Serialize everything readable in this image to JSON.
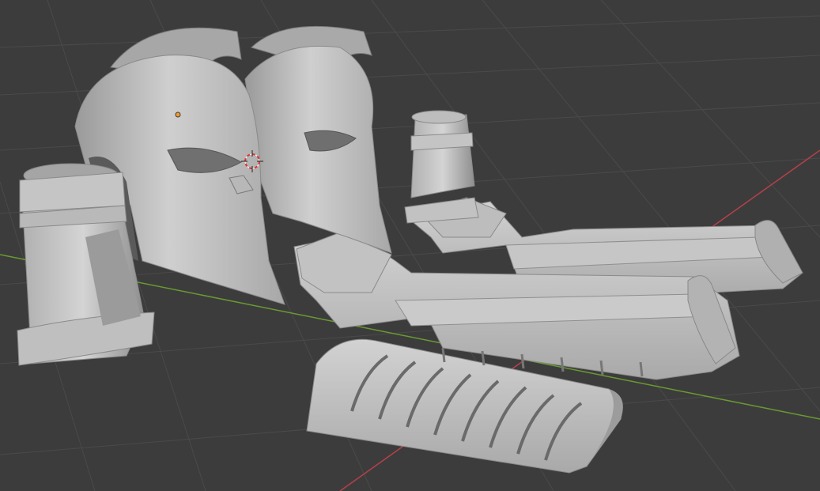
{
  "viewport": {
    "background": "#3c3c3c",
    "grid_color": "#4a4a4a",
    "x_axis_color": "#b5404a",
    "y_axis_color": "#6a9a32",
    "mesh_color": "#c8c8c8",
    "origin_color": "#f29a2e",
    "cursor_color": "#e03030"
  },
  "objects": [
    {
      "name": "helmet-front"
    },
    {
      "name": "helmet-back"
    },
    {
      "name": "bracer-left"
    },
    {
      "name": "bracer-right"
    },
    {
      "name": "pauldron-left"
    },
    {
      "name": "pauldron-right"
    },
    {
      "name": "forearm-guard"
    }
  ]
}
